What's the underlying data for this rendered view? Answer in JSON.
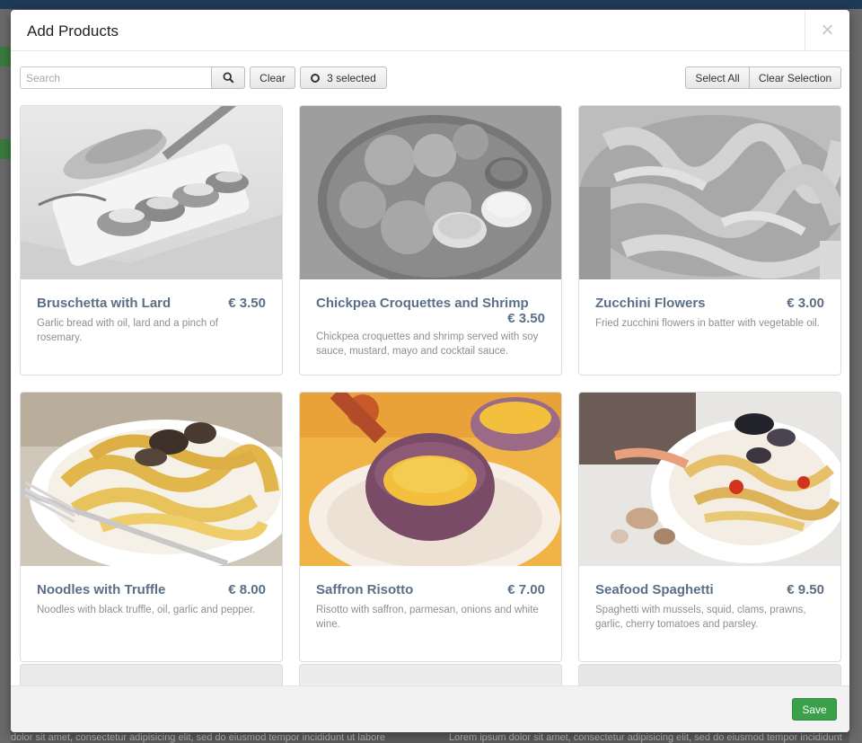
{
  "modal": {
    "title": "Add Products",
    "close_icon": "close-icon"
  },
  "toolbar": {
    "search_placeholder": "Search",
    "search_icon": "search-icon",
    "clear_label": "Clear",
    "selected_label": "3 selected",
    "select_all_label": "Select All",
    "clear_selection_label": "Clear Selection"
  },
  "products": [
    {
      "name": "Bruschetta with Lard",
      "price": "€ 3.50",
      "description": "Garlic bread with oil, lard and a pinch of rosemary.",
      "grayscale": true
    },
    {
      "name": "Chickpea Croquettes and Shrimp",
      "price": "€ 3.50",
      "description": "Chickpea croquettes and shrimp served with soy sauce, mustard, mayo and cocktail sauce.",
      "grayscale": true
    },
    {
      "name": "Zucchini Flowers",
      "price": "€ 3.00",
      "description": "Fried zucchini flowers in batter with vegetable oil.",
      "grayscale": true
    },
    {
      "name": "Noodles with Truffle",
      "price": "€ 8.00",
      "description": "Noodles with black truffle, oil, garlic and pepper.",
      "grayscale": false
    },
    {
      "name": "Saffron Risotto",
      "price": "€ 7.00",
      "description": "Risotto with saffron, parmesan, onions and white wine.",
      "grayscale": false
    },
    {
      "name": "Seafood Spaghetti",
      "price": "€ 9.50",
      "description": "Spaghetti with mussels, squid, clams, prawns, garlic, cherry tomatoes and parsley.",
      "grayscale": false
    }
  ],
  "footer": {
    "save_label": "Save"
  },
  "background": {
    "footer_text_left": "dolor sit amet, consectetur adipisicing elit, sed do eiusmod tempor incididunt ut labore",
    "footer_text_right": "Lorem ipsum dolor sit amet, consectetur adipisicing elit, sed do eiusmod tempor incididunt"
  },
  "colors": {
    "accent_green": "#3aa049",
    "product_title": "#5a6f86"
  }
}
